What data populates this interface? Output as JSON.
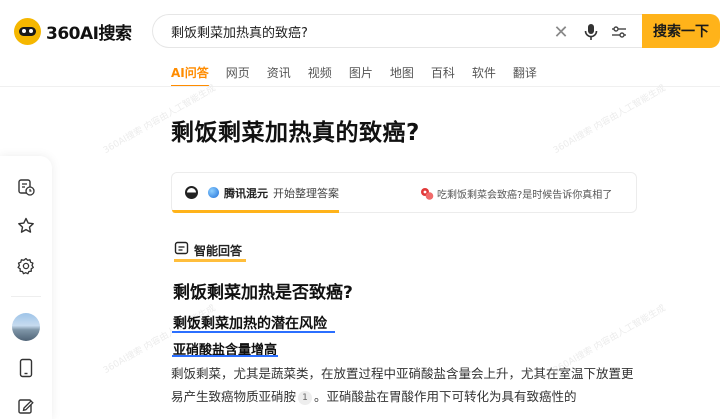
{
  "brand": {
    "name": "360AI搜索"
  },
  "search": {
    "value": "剩饭剩菜加热真的致癌?",
    "button_label": "搜索一下"
  },
  "tabs": [
    {
      "label": "AI问答",
      "active": true
    },
    {
      "label": "网页"
    },
    {
      "label": "资讯"
    },
    {
      "label": "视频"
    },
    {
      "label": "图片"
    },
    {
      "label": "地图"
    },
    {
      "label": "百科"
    },
    {
      "label": "软件"
    },
    {
      "label": "翻译"
    }
  ],
  "sidebar": {
    "items": [
      {
        "icon": "history-icon"
      },
      {
        "icon": "star-icon"
      },
      {
        "icon": "gear-icon"
      },
      {
        "icon": "avatar"
      },
      {
        "icon": "phone-icon"
      },
      {
        "icon": "edit-icon"
      }
    ]
  },
  "question": {
    "title": "剩饭剩菜加热真的致癌?"
  },
  "status": {
    "source": "腾讯混元",
    "text": "开始整理答案",
    "related": "吃剩饭剩菜会致癌?是时候告诉你真相了"
  },
  "answer": {
    "section_label": "智能回答",
    "heading": "剩饭剩菜加热是否致癌?",
    "subheading": "剩饭剩菜加热的潜在风险",
    "subsubheading": "亚硝酸盐含量增高",
    "paragraph_before_cite": "剩饭剩菜，尤其是蔬菜类，在放置过程中亚硝酸盐含量会上升，尤其在室温下放置更易产生致癌物质亚硝胺",
    "cite_number": "1",
    "paragraph_after_cite": "。亚硝酸盐在胃酸作用下可转化为具有致癌性的"
  },
  "colors": {
    "accent": "#ffb31a",
    "tab_active": "#ff8c00",
    "heading_underline": "#2b6fff"
  }
}
